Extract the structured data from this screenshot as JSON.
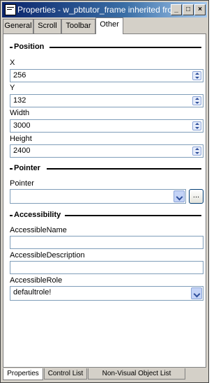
{
  "window": {
    "title": "Properties - w_pbtutor_frame inherited from wi",
    "buttons": {
      "minimize": "_",
      "maximize": "□",
      "close": "×"
    }
  },
  "tabs": [
    {
      "label": "General"
    },
    {
      "label": "Scroll"
    },
    {
      "label": "Toolbar"
    },
    {
      "label": "Other",
      "active": true
    }
  ],
  "sections": {
    "position": "Position",
    "pointer": "Pointer",
    "accessibility": "Accessibility"
  },
  "position": {
    "x_label": "X",
    "x_value": "256",
    "y_label": "Y",
    "y_value": "132",
    "width_label": "Width",
    "width_value": "3000",
    "height_label": "Height",
    "height_value": "2400"
  },
  "pointer": {
    "label": "Pointer",
    "value": "",
    "browse_label": "..."
  },
  "accessibility": {
    "name_label": "AccessibleName",
    "name_value": "",
    "description_label": "AccessibleDescription",
    "description_value": "",
    "role_label": "AccessibleRole",
    "role_value": "defaultrole!"
  },
  "bottom_tabs": [
    {
      "label": "Properties",
      "active": true
    },
    {
      "label": "Control List"
    },
    {
      "label": "Non-Visual Object List"
    }
  ],
  "colors": {
    "title_gradient_start": "#0a246a",
    "face": "#d4d0c8",
    "field_border": "#7f9db9"
  }
}
